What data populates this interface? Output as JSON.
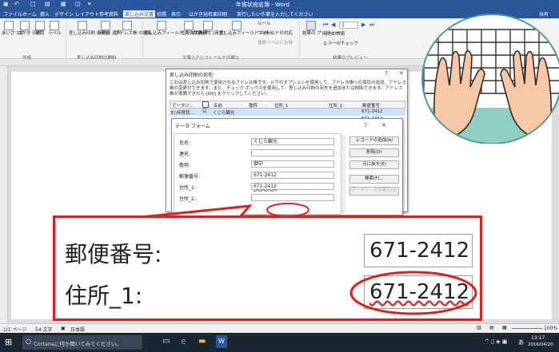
{
  "app": {
    "window_title": "年賀状宛名簿 - Word",
    "quick_access": [
      "H",
      "↶",
      "↷",
      "□",
      "■",
      "♥",
      "♦",
      "="
    ]
  },
  "tabs": [
    {
      "label": "ファイル"
    },
    {
      "label": "ホーム"
    },
    {
      "label": "挿入"
    },
    {
      "label": "デザイン"
    },
    {
      "label": "レイアウト"
    },
    {
      "label": "参考資料"
    },
    {
      "label": "差し込み文書",
      "active": true
    },
    {
      "label": "校閲"
    },
    {
      "label": "表示"
    },
    {
      "label": "はがき宛名面印刷"
    }
  ],
  "tell_me": "実行したい作業を入力してください",
  "share": "共有",
  "ribbon": {
    "buttons": [
      {
        "label": "あいさつ文"
      },
      {
        "label": "はがき 印刷"
      },
      {
        "label": "封筒"
      },
      {
        "label": "ラベル"
      },
      {
        "label": "差し込み印刷 の開始"
      },
      {
        "label": "宛先の 選択"
      },
      {
        "label": "アドレス帳 の編集"
      },
      {
        "label": "差し込みフィールド の強調表示"
      },
      {
        "label": "住所 ブロック"
      },
      {
        "label": "挨拶文 (英文)"
      },
      {
        "label": "差し込みフィールド の挿入"
      },
      {
        "label": "ルール"
      },
      {
        "label": "フィールドの対応"
      },
      {
        "label": "複数ラベルに反映"
      },
      {
        "label": "結果の プレビュー"
      },
      {
        "label": "宛先の検索"
      },
      {
        "label": "エラーのチェック"
      }
    ],
    "groups": [
      "作成",
      "差し込み印刷の開始",
      "文章入力とフィールドの挿入",
      "結果のプレビュー"
    ],
    "record_box": "1"
  },
  "recipients_dialog": {
    "title": "差し込み印刷の宛先",
    "help": "?",
    "description": "これは差し込み印刷で使用されるアドレス帳です。以下のオプションを使用して、アドレス帳への項目の追加、アドレス帳の変更ができます。また、チェック ボックスを使用して、差し込み印刷の宛先を追加または削除できます。アドレス帳が準備できたら [OK] をクリックしてください。",
    "columns": [
      "データソ...",
      "名前",
      "敬称",
      "住所_1",
      "住所_2",
      "郵便番号"
    ],
    "row": [
      "E:\\年賀状...",
      "☑",
      "くじら観光",
      "",
      "",
      "671-2412"
    ],
    "row2_zip": "671-2412",
    "side_letters": [
      "デ",
      "E",
      ""
    ]
  },
  "data_form": {
    "title": "データ フォーム",
    "help": "?",
    "close": "✕",
    "fields": [
      {
        "label": "氏名:",
        "value": "くじら観光"
      },
      {
        "label": "連名:",
        "value": ""
      },
      {
        "label": "敬称:",
        "value": "御中"
      },
      {
        "label": "郵便番号:",
        "value": "671-2412"
      },
      {
        "label": "住所_1:",
        "value": "671-2412"
      },
      {
        "label": "住所_2:",
        "value": ""
      }
    ],
    "buttons": [
      "レコードの追加(A)",
      "削除(D)",
      "元に戻す(E)",
      "検索(F)...",
      "データソースの表示(V)"
    ]
  },
  "zoom_callout": {
    "rows": [
      {
        "label": "郵便番号:",
        "value": "671-2412"
      },
      {
        "label": "住所_1:",
        "value": "671-2412"
      }
    ],
    "highlight_color": "#e21d1d"
  },
  "statusbar": {
    "page": "1/1 ページ",
    "words": "54 文字",
    "language": "日本語",
    "zoom": "100%"
  },
  "taskbar": {
    "search_placeholder": "Cortanaに何か聞いてみてください。",
    "time": "13:17",
    "date": "2016/04/20",
    "ime": "あ"
  },
  "colors": {
    "word_blue": "#2b579a",
    "highlight_red": "#e21d1d",
    "taskbar": "#1b2633",
    "inset_teal": "#4e9a8e"
  }
}
